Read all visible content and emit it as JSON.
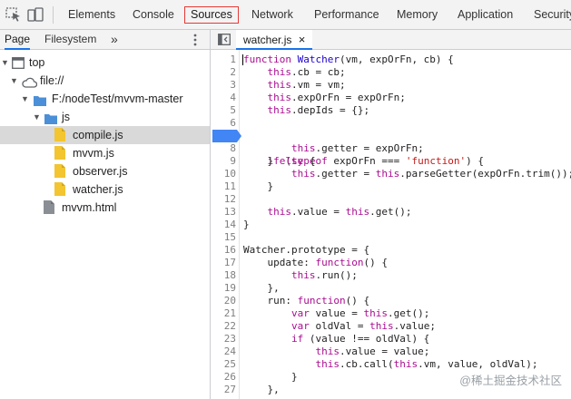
{
  "toolbar": {
    "tabs": [
      "Elements",
      "Console",
      "Sources",
      "Network",
      "Performance",
      "Memory",
      "Application",
      "Security"
    ],
    "active_tab": "Sources"
  },
  "navigator": {
    "tabs": [
      "Page",
      "Filesystem"
    ],
    "more_label": "»",
    "tree": {
      "top": "top",
      "origin": "file://",
      "folder": "F:/nodeTest/mvvm-master",
      "js_folder": "js",
      "files": [
        "compile.js",
        "mvvm.js",
        "observer.js",
        "watcher.js"
      ],
      "html_file": "mvvm.html",
      "selected": "compile.js"
    }
  },
  "editor": {
    "file_tab": "watcher.js",
    "close_label": "×",
    "breakpoint_line": 7,
    "line_numbers": [
      1,
      2,
      3,
      4,
      5,
      6,
      7,
      8,
      9,
      10,
      11,
      12,
      13,
      14,
      15,
      16,
      17,
      18,
      19,
      20,
      21,
      22,
      23,
      24,
      25,
      26,
      27
    ]
  },
  "watermark": "@稀土掘金技术社区",
  "colors": {
    "accent": "#1a73e8",
    "active_tab_border": "#e53935",
    "breakpoint": "#4285f4",
    "keyword": "#aa0d91",
    "string": "#c41a16"
  }
}
